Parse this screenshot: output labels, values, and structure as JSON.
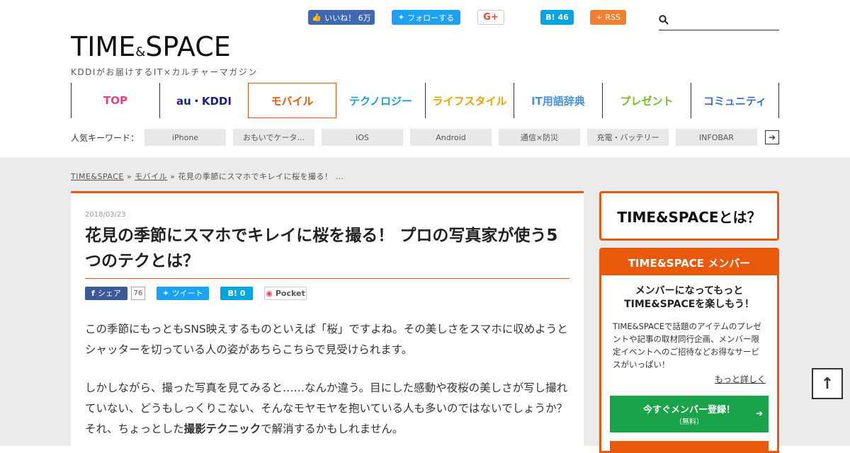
{
  "social": {
    "facebook_label": "いいね！ 6万",
    "twitter_label": "フォローする",
    "googleplus_label": "G+",
    "hatena_label": "B! 46",
    "rss_label": "RSS"
  },
  "search": {
    "placeholder": ""
  },
  "logo": {
    "main_a": "TIME",
    "amp": "&",
    "main_b": "SPACE",
    "sub": "KDDIがお届けするIT×カルチャーマガジン"
  },
  "nav": {
    "items": [
      {
        "label": "TOP",
        "color": "#e63e86"
      },
      {
        "label": "au・KDDI",
        "color": "#1a237e"
      },
      {
        "label": "モバイル",
        "color": "#e8590c"
      },
      {
        "label": "テクノロジー",
        "color": "#1ba0c7"
      },
      {
        "label": "ライフスタイル",
        "color": "#f0a000"
      },
      {
        "label": "IT用語辞典",
        "color": "#4a90d9"
      },
      {
        "label": "プレゼント",
        "color": "#7cb82f"
      },
      {
        "label": "コミュニティ",
        "color": "#3b6fc9"
      }
    ]
  },
  "keywords": {
    "label": "人気キーワード：",
    "tags": [
      "iPhone",
      "おもいでケータ...",
      "iOS",
      "Android",
      "通信×防災",
      "充電・バッテリー",
      "INFOBAR"
    ],
    "more_icon": "arrow-right-icon"
  },
  "breadcrumb": {
    "home": "TIME&SPACE",
    "sep1": "»",
    "category": "モバイル",
    "sep2": "»",
    "current": "花見の季節にスマホでキレイに桜を撮る！ ..."
  },
  "article": {
    "date": "2018/03/23",
    "title": "花見の季節にスマホでキレイに桜を撮る！ プロの写真家が使う5つのテクとは？",
    "share": {
      "facebook": "シェア",
      "facebook_count": "76",
      "twitter": "ツイート",
      "hatena": "B! 0",
      "pocket": "Pocket"
    },
    "paragraphs": [
      "この季節にもっともSNS映えするものといえば「桜」ですよね。その美しさをスマホに収めようとシャッターを切っている人の姿があちらこちらで見受けられます。",
      "しかしながら、撮った写真を見てみると……なんか違う。目にした感動や夜桜の美しさが写し撮れていない、どうもしっくりこない、そんなモヤモヤを抱いている人も多いのではないでしょうか？ それ、ちょっとした"
    ],
    "p2_bold": "撮影テクニック",
    "p2_tail": "で解消するかもしれません。"
  },
  "sidebar": {
    "about": "TIME&SPACEとは？",
    "member_head": "TIME&SPACE メンバー",
    "member_title_1": "メンバーになってもっと",
    "member_title_2": "TIME&SPACEを楽しもう！",
    "member_desc": "TIME&SPACEで話題のアイテムのプレゼントや記事の取材同行企画、メンバー限定イベントへのご招待などお得なサービスがいっぱい！",
    "member_more": "もっと詳しく",
    "register_label": "今すぐメンバー登録！",
    "register_sub": "（無料）"
  },
  "totop": {
    "icon": "arrow-up-icon"
  }
}
